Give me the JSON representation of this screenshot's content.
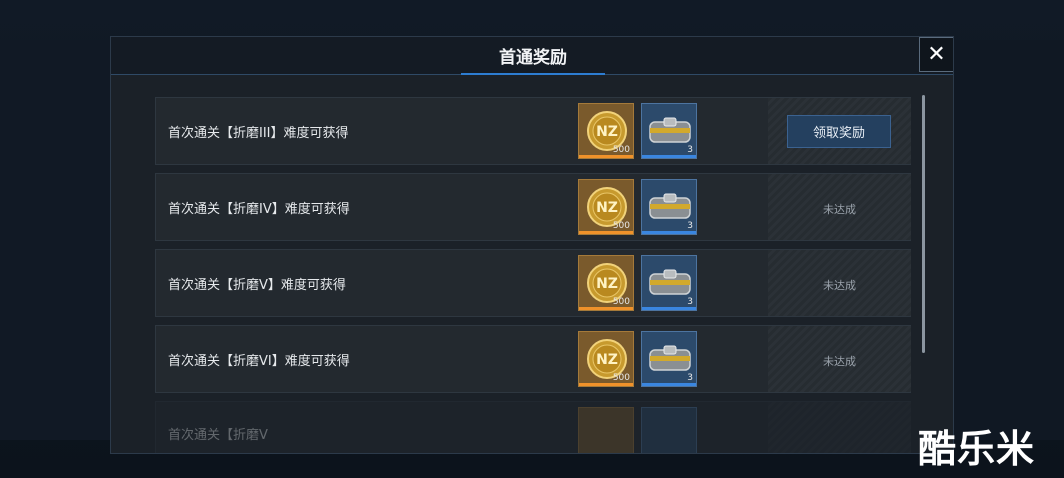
{
  "modal": {
    "title": "首通奖励",
    "close_label": "✕"
  },
  "rows": [
    {
      "label": "首次通关【折磨III】难度可获得",
      "coin_qty": "500",
      "chest_qty": "3",
      "status": "领取奖励",
      "claimable": true
    },
    {
      "label": "首次通关【折磨IV】难度可获得",
      "coin_qty": "500",
      "chest_qty": "3",
      "status": "未达成",
      "claimable": false
    },
    {
      "label": "首次通关【折磨V】难度可获得",
      "coin_qty": "500",
      "chest_qty": "3",
      "status": "未达成",
      "claimable": false
    },
    {
      "label": "首次通关【折磨VI】难度可获得",
      "coin_qty": "500",
      "chest_qty": "3",
      "status": "未达成",
      "claimable": false
    },
    {
      "label": "首次通关【折磨V",
      "coin_qty": "",
      "chest_qty": "",
      "status": "",
      "claimable": false
    }
  ],
  "watermark": "酷乐米",
  "colors": {
    "accent": "#2d7dd2",
    "coin_bar": "#f0922a",
    "chest_bar": "#3a86e0"
  },
  "icons": {
    "coin": "nz-coin-icon",
    "chest": "supply-chest-icon",
    "close": "close-icon"
  }
}
